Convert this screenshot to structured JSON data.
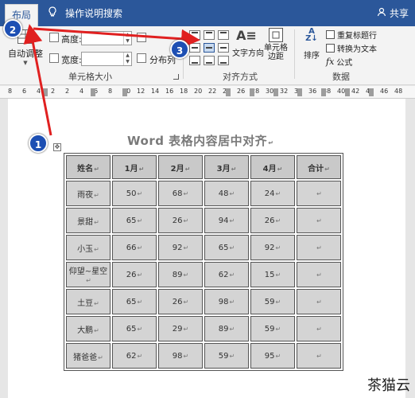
{
  "tabbar": {
    "active_tab": "布局",
    "tell_me": "操作说明搜索",
    "share": "共享"
  },
  "ribbon": {
    "autofit_label": "自动调整",
    "height_label": "高度:",
    "width_label": "宽度:",
    "distribute_label": "分布列",
    "cell_size_group": "单元格大小",
    "text_direction_label": "文字方向",
    "cell_margin_label": "单元格\n边距",
    "alignment_group": "对齐方式",
    "sort_label": "排序",
    "repeat_header_label": "重复标题行",
    "convert_text_label": "转换为文本",
    "formula_label": "公式",
    "data_group": "数据"
  },
  "ruler": {
    "numbers": [
      "8",
      "6",
      "4",
      "2",
      "2",
      "4",
      "6",
      "8",
      "10",
      "12",
      "14",
      "16",
      "18",
      "20",
      "22",
      "24",
      "26",
      "28",
      "30",
      "32",
      "34",
      "36",
      "38",
      "40",
      "42",
      "44",
      "46",
      "48"
    ]
  },
  "document": {
    "title": "Word 表格内容居中对齐",
    "table": {
      "headers": [
        "姓名",
        "1月",
        "2月",
        "3月",
        "4月",
        "合计"
      ],
      "rows": [
        [
          "雨夜",
          "50",
          "68",
          "48",
          "24",
          ""
        ],
        [
          "景甜",
          "65",
          "26",
          "94",
          "26",
          ""
        ],
        [
          "小玉",
          "66",
          "92",
          "65",
          "92",
          ""
        ],
        [
          "仰望~星空",
          "26",
          "89",
          "62",
          "15",
          ""
        ],
        [
          "土豆",
          "65",
          "26",
          "98",
          "59",
          ""
        ],
        [
          "大鹏",
          "65",
          "29",
          "89",
          "59",
          ""
        ],
        [
          "猪爸爸",
          "62",
          "98",
          "59",
          "95",
          ""
        ]
      ]
    }
  },
  "badges": [
    "1",
    "2",
    "3"
  ],
  "watermark": "茶猫云",
  "colors": {
    "tabbar": "#2b579a",
    "badge": "#1d4fb3",
    "arrow": "#e02020"
  }
}
